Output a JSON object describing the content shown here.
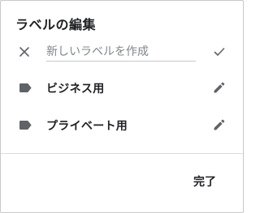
{
  "dialog": {
    "title": "ラベルの編集"
  },
  "new_label": {
    "placeholder": "新しいラベルを作成",
    "value": "",
    "cancel_icon": "close-icon",
    "confirm_icon": "check-icon"
  },
  "labels": [
    {
      "name": "ビジネス用",
      "icon": "label-tag-icon",
      "action_icon": "edit-pencil-icon"
    },
    {
      "name": "プライベート用",
      "icon": "label-tag-icon",
      "action_icon": "edit-pencil-icon"
    }
  ],
  "footer": {
    "done_label": "完了"
  },
  "colors": {
    "text": "#202124",
    "icon": "#5f6368",
    "divider": "#dadce0",
    "border": "#c8c8c8"
  }
}
